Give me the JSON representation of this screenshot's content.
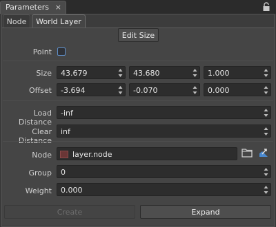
{
  "window": {
    "title": "Parameters",
    "close_glyph": "×",
    "lock_icon": "lock-icon"
  },
  "tabs": [
    {
      "label": "Node",
      "active": false
    },
    {
      "label": "World Layer",
      "active": true
    }
  ],
  "edit_size_label": "Edit Size",
  "point": {
    "label": "Point",
    "checked": false
  },
  "size": {
    "label": "Size",
    "values": [
      "43.679",
      "43.680",
      "1.000"
    ]
  },
  "offset": {
    "label": "Offset",
    "values": [
      "-3.694",
      "-0.070",
      "0.000"
    ]
  },
  "load_distance": {
    "label": "Load Distance",
    "value": "-inf"
  },
  "clear_distance": {
    "label": "Clear Distance",
    "value": "inf"
  },
  "node": {
    "label": "Node",
    "value": "layer.node",
    "folder_icon": "folder-icon",
    "locate_icon": "locate-node-icon"
  },
  "group": {
    "label": "Group",
    "value": "0"
  },
  "weight": {
    "label": "Weight",
    "value": "0.000"
  },
  "create_label": "Create",
  "expand_label": "Expand",
  "colors": {
    "accent_checkbox": "#5f8fc9",
    "field_bg": "#2d2d2d",
    "panel_bg": "#454545"
  }
}
